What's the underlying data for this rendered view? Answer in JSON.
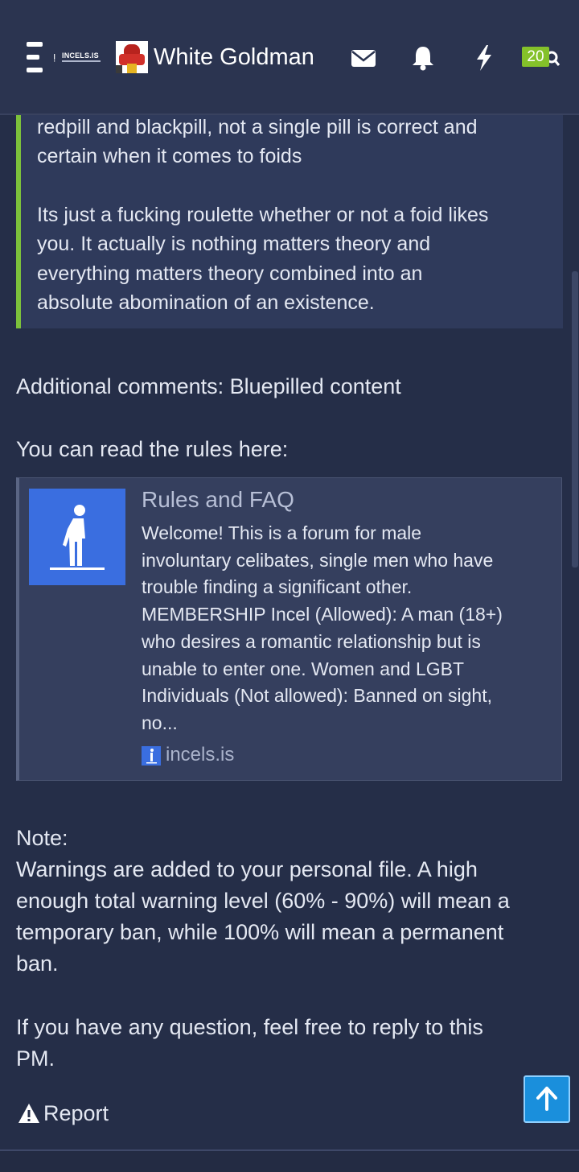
{
  "header": {
    "logo_text": "INCELS.IS",
    "username": "White Goldman",
    "icons": [
      "menu-icon",
      "logo-icon",
      "envelope-icon",
      "bell-icon",
      "bolt-icon",
      "search-icon"
    ],
    "alerts_count": "20"
  },
  "quote": {
    "para1_line1": "redpill and blackpill, not a single pill is correct and",
    "para1_line2": "certain when it comes to foids",
    "para2_line1": "Its just a fucking roulette whether or not a foid likes",
    "para2_line2": "you. It actually is nothing matters theory and",
    "para2_line3": "everything matters theory combined into an",
    "para2_line4": "absolute abomination of an existence."
  },
  "message": {
    "additional_comments": "Additional comments: Bluepilled content",
    "rules_intro": "You can read the rules here:",
    "note_label": "Note:",
    "note_line1": "Warnings are added to your personal file. A high",
    "note_line2": "enough total warning level (60% - 90%) will mean a",
    "note_line3": "temporary ban, while 100% will mean a permanent",
    "note_line4": "ban.",
    "question_line1": "If you have any question, feel free to reply to this",
    "question_line2": "PM."
  },
  "card": {
    "title": "Rules and FAQ",
    "desc_lines": [
      "Welcome! This is a forum for male",
      "involuntary celibates, single men who have",
      "trouble finding a significant other.",
      "MEMBERSHIP Incel (Allowed): A man (18+)",
      "who desires a romantic relationship but is",
      "unable to enter one. Women and LGBT",
      "Individuals (Not allowed): Banned on sight,",
      "no..."
    ],
    "domain": "incels.is"
  },
  "actions": {
    "report_label": "Report"
  },
  "colors": {
    "background": "#252e48",
    "header": "#2b3450",
    "quote_bg": "#2f3a5b",
    "quote_border": "#7cc13b",
    "badge": "#84c12a",
    "accent_blue": "#1a8fdc",
    "card_image": "#3a6ee0"
  }
}
